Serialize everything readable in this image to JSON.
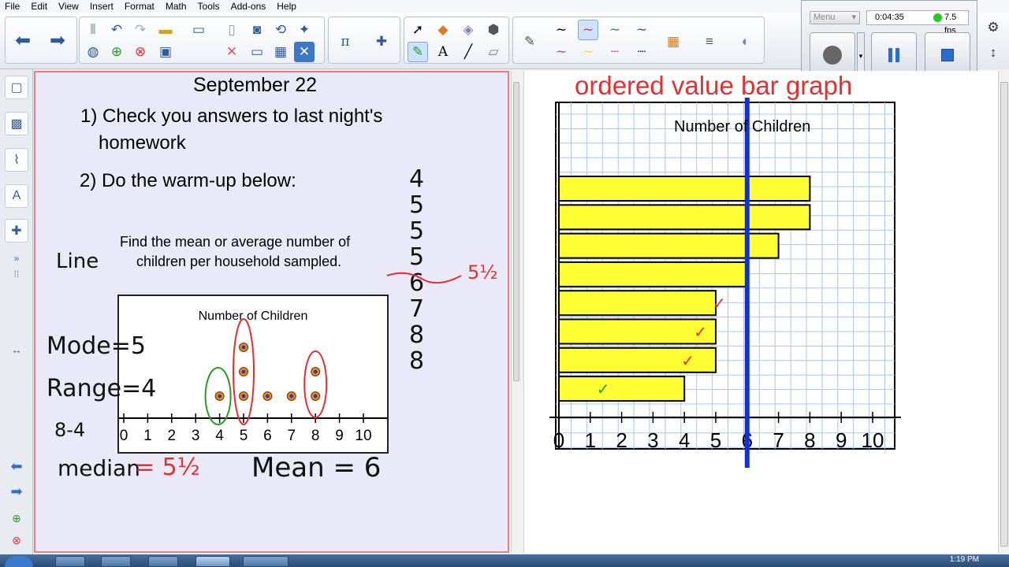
{
  "menu": [
    "File",
    "Edit",
    "View",
    "Insert",
    "Format",
    "Math",
    "Tools",
    "Add-ons",
    "Help"
  ],
  "recorder": {
    "menu_label": "Menu",
    "elapsed": "0:04:35",
    "fps": "7.5 fps"
  },
  "left_page": {
    "date": "September 22",
    "step1_line1": "1) Check you answers to last night's",
    "step1_line2": "homework",
    "step2": "2) Do the warm-up below:",
    "prompt_line1": "Find the mean or average number of",
    "prompt_line2": "children per household sampled.",
    "dot_plot_title": "Number of Children",
    "dot_plot_ticks": [
      "0",
      "1",
      "2",
      "3",
      "4",
      "5",
      "6",
      "7",
      "8",
      "9",
      "10"
    ],
    "handwriting": {
      "line": "Line",
      "mode": "Mode=5",
      "range": "Range=4",
      "diff": "8-4",
      "median_label": "median",
      "median_value": "= 5½",
      "mean": "Mean = 6",
      "ordered_list": [
        "4",
        "5",
        "5",
        "5",
        "6",
        "7",
        "8",
        "8"
      ],
      "list_median": "5½"
    }
  },
  "right_page": {
    "heading": "ordered value bar graph",
    "chart_title": "Number of Children",
    "ticks": [
      "0",
      "1",
      "2",
      "3",
      "4",
      "5",
      "6",
      "7",
      "8",
      "9",
      "10"
    ],
    "checkmark": "✓"
  },
  "taskbar": {
    "clock": "1:19 PM"
  },
  "colors": {
    "ink_black": "#111111",
    "ink_red": "#e53030",
    "ink_green": "#2a9a2a",
    "bar_fill": "#ffff33",
    "mean_line": "#1030e0",
    "left_page_bg": "#e9e9f7",
    "grid": "#a9c6ea"
  },
  "chart_data": [
    {
      "type": "scatter",
      "title": "Number of Children",
      "xlim": [
        0,
        10
      ],
      "x": [
        4,
        5,
        5,
        5,
        6,
        7,
        8,
        8
      ],
      "y": [
        1,
        1,
        2,
        3,
        1,
        1,
        1,
        2
      ],
      "ylabel": "",
      "xlabel": ""
    },
    {
      "type": "bar",
      "orientation": "horizontal",
      "title": "Number of Children",
      "values": [
        8,
        8,
        7,
        6,
        5,
        5,
        5,
        4
      ],
      "xlim": [
        0,
        10
      ],
      "reference_line": 6,
      "grid": true,
      "checked_rows": [
        5,
        6,
        7,
        8
      ]
    }
  ]
}
